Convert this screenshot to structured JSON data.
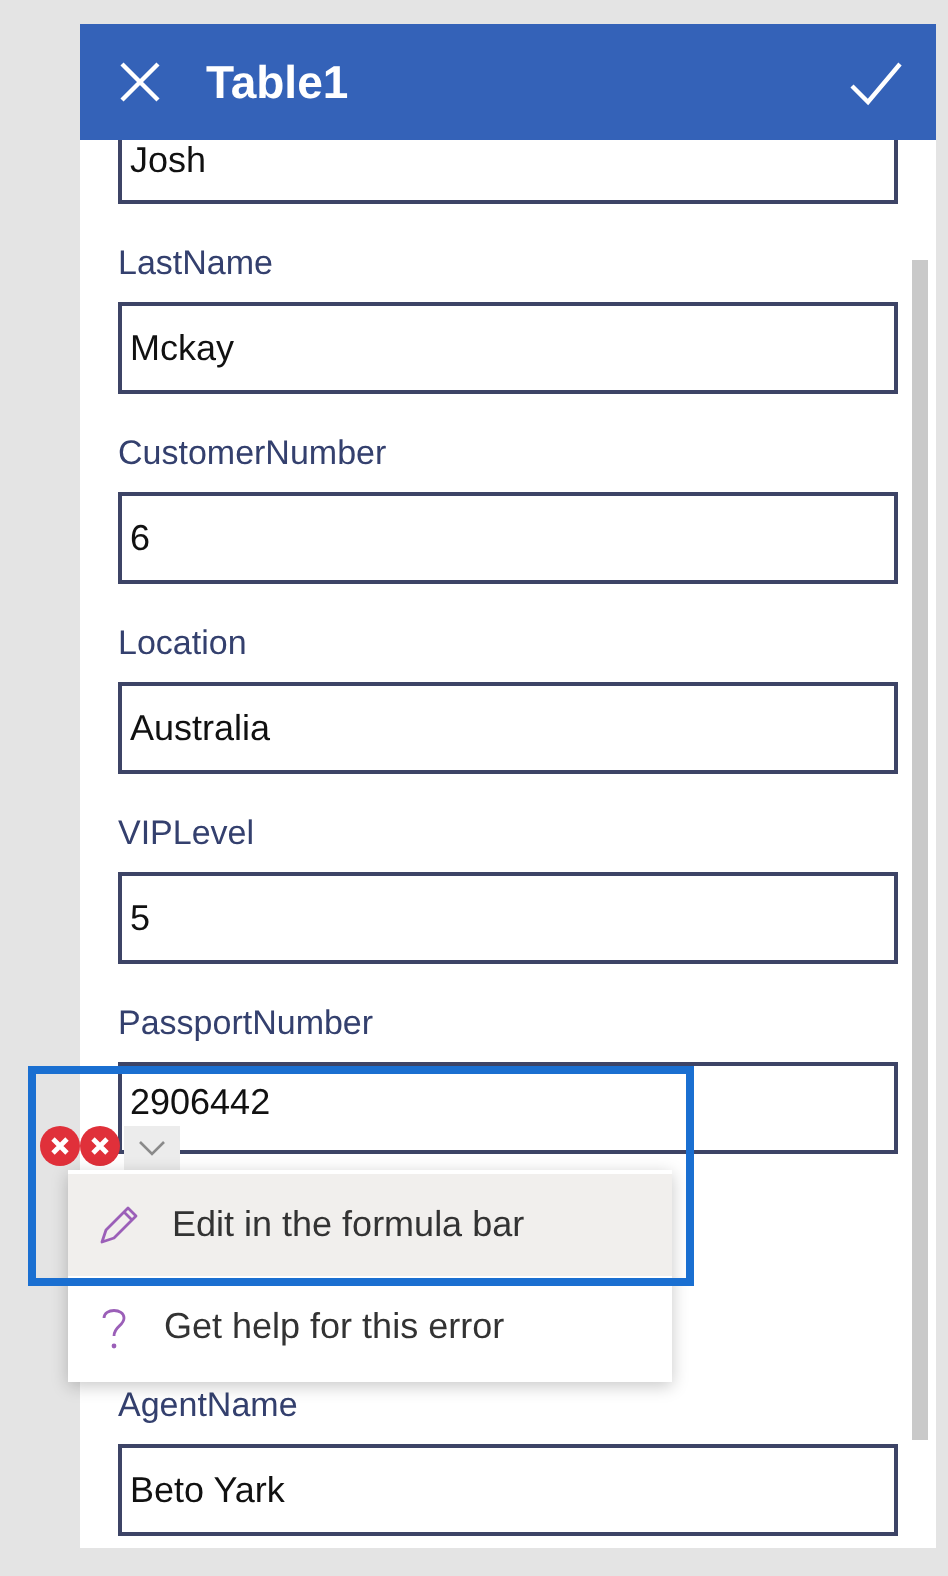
{
  "form": {
    "title": "Table1",
    "fields": [
      {
        "value": "Josh"
      },
      {
        "label": "LastName",
        "value": "Mckay"
      },
      {
        "label": "CustomerNumber",
        "value": "6"
      },
      {
        "label": "Location",
        "value": "Australia"
      },
      {
        "label": "VIPLevel",
        "value": "5"
      },
      {
        "label": "PassportNumber",
        "value": "2906442",
        "error": true,
        "selected": true
      },
      {
        "label": "AgentName",
        "value": "Beto Yark"
      }
    ]
  },
  "error_menu": [
    {
      "kind": "edit",
      "label": "Edit in the formula bar",
      "hovered": true
    },
    {
      "kind": "help",
      "label": "Get help for this error",
      "hovered": false
    }
  ]
}
